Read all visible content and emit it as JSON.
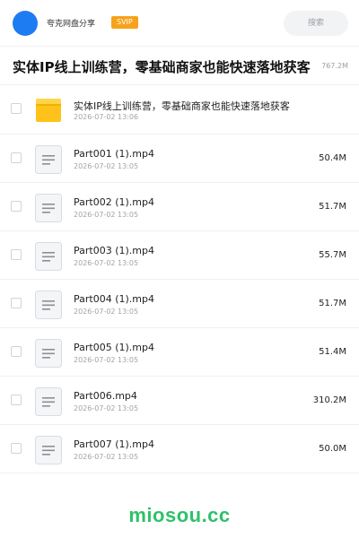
{
  "header": {
    "share_name": "夸克网盘分享",
    "badge": "SVIP",
    "search_label": "搜索",
    "avatar_color": "#1e7cf2",
    "badge_color": "#f7a21b"
  },
  "folder_title": "实体IP线上训练营，零基础商家也能快速落地获客",
  "total_size": "767.2M",
  "files": [
    {
      "name": "实体IP线上训练营，零基础商家也能快速落地获客",
      "date": "2026-07-02 13:06",
      "size": "",
      "icon": "folder-icon"
    },
    {
      "name": "Part001 (1).mp4",
      "date": "2026-07-02 13:05",
      "size": "50.4M",
      "icon": "video-file-icon"
    },
    {
      "name": "Part002 (1).mp4",
      "date": "2026-07-02 13:05",
      "size": "51.7M",
      "icon": "video-file-icon"
    },
    {
      "name": "Part003 (1).mp4",
      "date": "2026-07-02 13:05",
      "size": "55.7M",
      "icon": "video-file-icon"
    },
    {
      "name": "Part004 (1).mp4",
      "date": "2026-07-02 13:05",
      "size": "51.7M",
      "icon": "video-file-icon"
    },
    {
      "name": "Part005 (1).mp4",
      "date": "2026-07-02 13:05",
      "size": "51.4M",
      "icon": "video-file-icon"
    },
    {
      "name": "Part006.mp4",
      "date": "2026-07-02 13:05",
      "size": "310.2M",
      "icon": "video-file-icon"
    },
    {
      "name": "Part007 (1).mp4",
      "date": "2026-07-02 13:05",
      "size": "50.0M",
      "icon": "video-file-icon"
    }
  ],
  "watermark": "miosou.cc",
  "watermark_color": "#2ec16a"
}
